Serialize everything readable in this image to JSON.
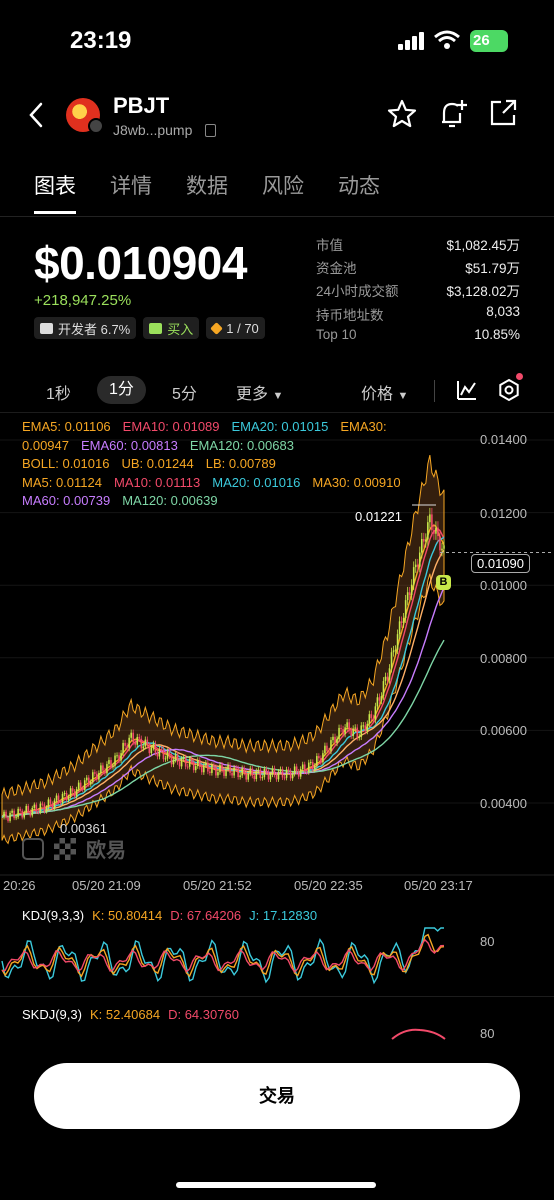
{
  "status_bar": {
    "time": "23:19",
    "battery": "26"
  },
  "header": {
    "symbol": "PBJT",
    "address": "J8wb...pump"
  },
  "tabs": [
    "图表",
    "详情",
    "数据",
    "风险",
    "动态"
  ],
  "price": {
    "value": "$0.010904",
    "change": "+218,947.25%",
    "tags": {
      "dev": "开发者 6.7%",
      "buy": "买入",
      "rank": "1 / 70"
    }
  },
  "stats": [
    {
      "k": "市值",
      "v": "$1,082.45万"
    },
    {
      "k": "资金池",
      "v": "$51.79万"
    },
    {
      "k": "24小时成交额",
      "v": "$3,128.02万"
    },
    {
      "k": "持币地址数",
      "v": "8,033"
    },
    {
      "k": "Top 10",
      "v": "10.85%"
    }
  ],
  "intervals": {
    "i1": "1秒",
    "i2": "1分",
    "i3": "5分",
    "more": "更多",
    "price": "价格"
  },
  "indicators": {
    "ema5": "EMA5: 0.01106",
    "ema10": "EMA10: 0.01089",
    "ema20": "EMA20: 0.01015",
    "ema30": "EMA30:",
    "ema30v": "0.00947",
    "ema60": "EMA60: 0.00813",
    "ema120": "EMA120: 0.00683",
    "boll": "BOLL: 0.01016",
    "ub": "UB: 0.01244",
    "lb": "LB: 0.00789",
    "ma5": "MA5: 0.01124",
    "ma10": "MA10: 0.01113",
    "ma20": "MA20: 0.01016",
    "ma30": "MA30: 0.00910",
    "ma60": "MA60: 0.00739",
    "ma120": "MA120: 0.00639"
  },
  "chart_data": {
    "type": "candlestick",
    "y_ticks": [
      "0.01400",
      "0.01200",
      "0.01000",
      "0.00800",
      "0.00600",
      "0.00400"
    ],
    "x_ticks": [
      "20:26",
      "05/20 21:09",
      "05/20 21:52",
      "05/20 22:35",
      "05/20 23:17"
    ],
    "high_label": "0.01221",
    "low_label": "0.00361",
    "current_price": "0.01090",
    "marker": "B",
    "close": [
      0.0036,
      0.0037,
      0.0038,
      0.0039,
      0.0041,
      0.0043,
      0.0046,
      0.0049,
      0.0052,
      0.0058,
      0.0056,
      0.0054,
      0.0052,
      0.0051,
      0.005,
      0.0049,
      0.0049,
      0.0048,
      0.0048,
      0.0048,
      0.0048,
      0.0049,
      0.0051,
      0.0056,
      0.0061,
      0.0059,
      0.0064,
      0.0075,
      0.009,
      0.0105,
      0.0118,
      0.0109
    ]
  },
  "watermark": "欧易",
  "kdj": {
    "label": "KDJ(9,3,3)",
    "k": "K: 50.80414",
    "d": "D: 67.64206",
    "j": "J: 17.12830",
    "tick": "80"
  },
  "skdj": {
    "label": "SKDJ(9,3)",
    "k": "K: 52.40684",
    "d": "D: 64.30760",
    "tick": "80"
  },
  "trade_button": "交易",
  "colors": {
    "up": "#c8e84a",
    "down": "#f24a6a",
    "accent": "#9be05c"
  }
}
